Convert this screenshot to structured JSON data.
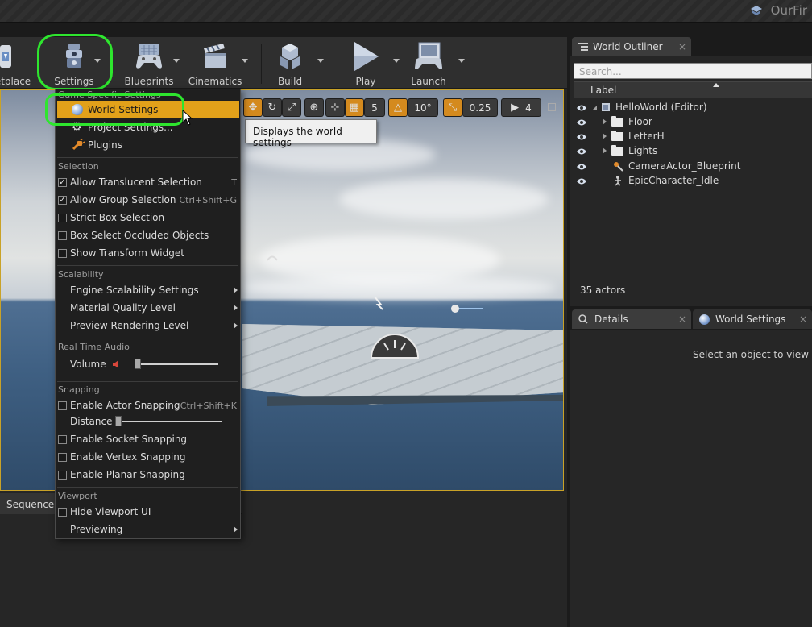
{
  "window": {
    "project_name": "OurFir"
  },
  "toolbar": {
    "items": [
      {
        "label": "etplace"
      },
      {
        "label": "Settings"
      },
      {
        "label": "Blueprints"
      },
      {
        "label": "Cinematics"
      },
      {
        "label": "Build"
      },
      {
        "label": "Play"
      },
      {
        "label": "Launch"
      }
    ]
  },
  "viewport_toolbar": {
    "grid_snap": "5",
    "rotation_snap": "10°",
    "scale_snap": "0.25",
    "camera_speed": "4"
  },
  "tooltip": "Displays the world settings",
  "settings_menu": {
    "header_partial": "Game Specific Settings",
    "world_settings": "World Settings",
    "project_settings": "Project Settings...",
    "plugins": "Plugins",
    "selection": {
      "heading": "Selection",
      "allow_translucent": {
        "label": "Allow Translucent Selection",
        "shortcut": "T",
        "checked": true
      },
      "allow_group": {
        "label": "Allow Group Selection",
        "shortcut": "Ctrl+Shift+G",
        "checked": true
      },
      "strict_box": {
        "label": "Strict Box Selection",
        "checked": false
      },
      "box_occluded": {
        "label": "Box Select Occluded Objects",
        "checked": false
      },
      "transform_widget": {
        "label": "Show Transform Widget",
        "checked": false
      }
    },
    "scalability": {
      "heading": "Scalability",
      "engine": "Engine Scalability Settings",
      "material": "Material Quality Level",
      "preview": "Preview Rendering Level"
    },
    "audio": {
      "heading": "Real Time Audio",
      "volume_label": "Volume",
      "volume_level": 0.0
    },
    "snapping": {
      "heading": "Snapping",
      "actor": {
        "label": "Enable Actor Snapping",
        "shortcut": "Ctrl+Shift+K",
        "checked": false
      },
      "distance_label": "Distance",
      "distance_level": 0.0,
      "socket": {
        "label": "Enable Socket Snapping",
        "checked": false
      },
      "vertex": {
        "label": "Enable Vertex Snapping",
        "checked": false
      },
      "planar": {
        "label": "Enable Planar Snapping",
        "checked": false
      }
    },
    "viewport": {
      "heading": "Viewport",
      "hide_ui": {
        "label": "Hide Viewport UI",
        "checked": false
      },
      "previewing": "Previewing"
    }
  },
  "sequencer": {
    "tab": "Sequencer"
  },
  "outliner": {
    "tab": "World Outliner",
    "close": "×",
    "search_placeholder": "Search...",
    "column_label": "Label",
    "rows": [
      {
        "label": "HelloWorld (Editor)"
      },
      {
        "label": "Floor"
      },
      {
        "label": "LetterH"
      },
      {
        "label": "Lights"
      },
      {
        "label": "CameraActor_Blueprint"
      },
      {
        "label": "EpicCharacter_Idle"
      }
    ],
    "actor_count": "35 actors"
  },
  "details": {
    "tab": "Details",
    "close": "×",
    "world_settings_tab": "World Settings",
    "empty_message": "Select an object to view deta"
  },
  "colors": {
    "accent": "#e2a11a",
    "highlight": "#2ee62e",
    "viewport_border": "#c9a227"
  }
}
